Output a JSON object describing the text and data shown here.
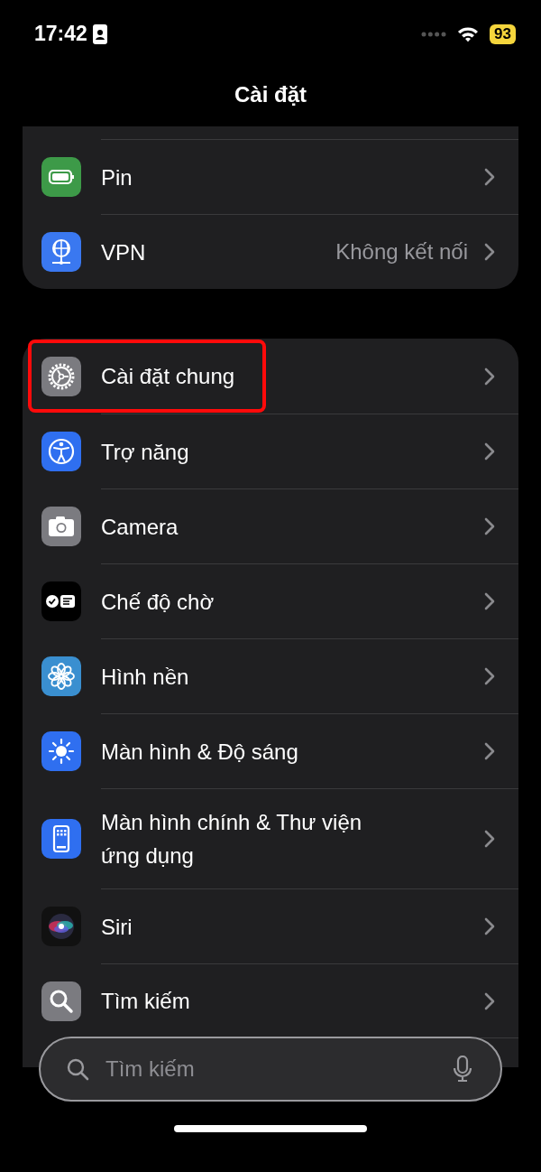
{
  "status_bar": {
    "time": "17:42",
    "battery": "93"
  },
  "title": "Cài đặt",
  "groups": [
    {
      "items": [
        {
          "label": "Pin",
          "highlighted": false
        },
        {
          "label": "VPN",
          "value": "Không kết nối",
          "highlighted": false
        }
      ]
    },
    {
      "items": [
        {
          "label": "Cài đặt chung",
          "highlighted": true
        },
        {
          "label": "Trợ năng",
          "highlighted": false
        },
        {
          "label": "Camera",
          "highlighted": false
        },
        {
          "label": "Chế độ chờ",
          "highlighted": false
        },
        {
          "label": "Hình nền",
          "highlighted": false
        },
        {
          "label": "Màn hình & Độ sáng",
          "highlighted": false
        },
        {
          "label": "Màn hình chính & Thư viện ứng dụng",
          "highlighted": false
        },
        {
          "label": "Siri",
          "highlighted": false
        },
        {
          "label": "Tìm kiếm",
          "highlighted": false
        }
      ]
    }
  ],
  "search": {
    "placeholder": "Tìm kiếm"
  }
}
